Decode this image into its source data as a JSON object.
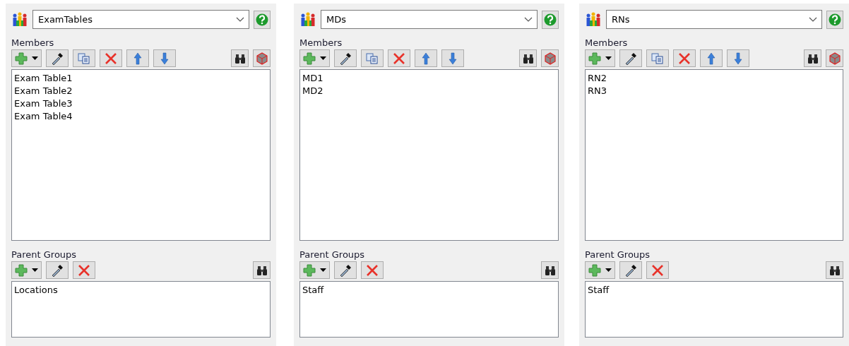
{
  "panels": [
    {
      "group": "ExamTables",
      "members_label": "Members",
      "members": [
        "Exam Table1",
        "Exam Table2",
        "Exam Table3",
        "Exam Table4"
      ],
      "parents_label": "Parent Groups",
      "parents": [
        "Locations"
      ]
    },
    {
      "group": "MDs",
      "members_label": "Members",
      "members": [
        "MD1",
        "MD2"
      ],
      "parents_label": "Parent Groups",
      "parents": [
        "Staff"
      ]
    },
    {
      "group": "RNs",
      "members_label": "Members",
      "members": [
        "RN2",
        "RN3"
      ],
      "parents_label": "Parent Groups",
      "parents": [
        "Staff"
      ]
    }
  ]
}
